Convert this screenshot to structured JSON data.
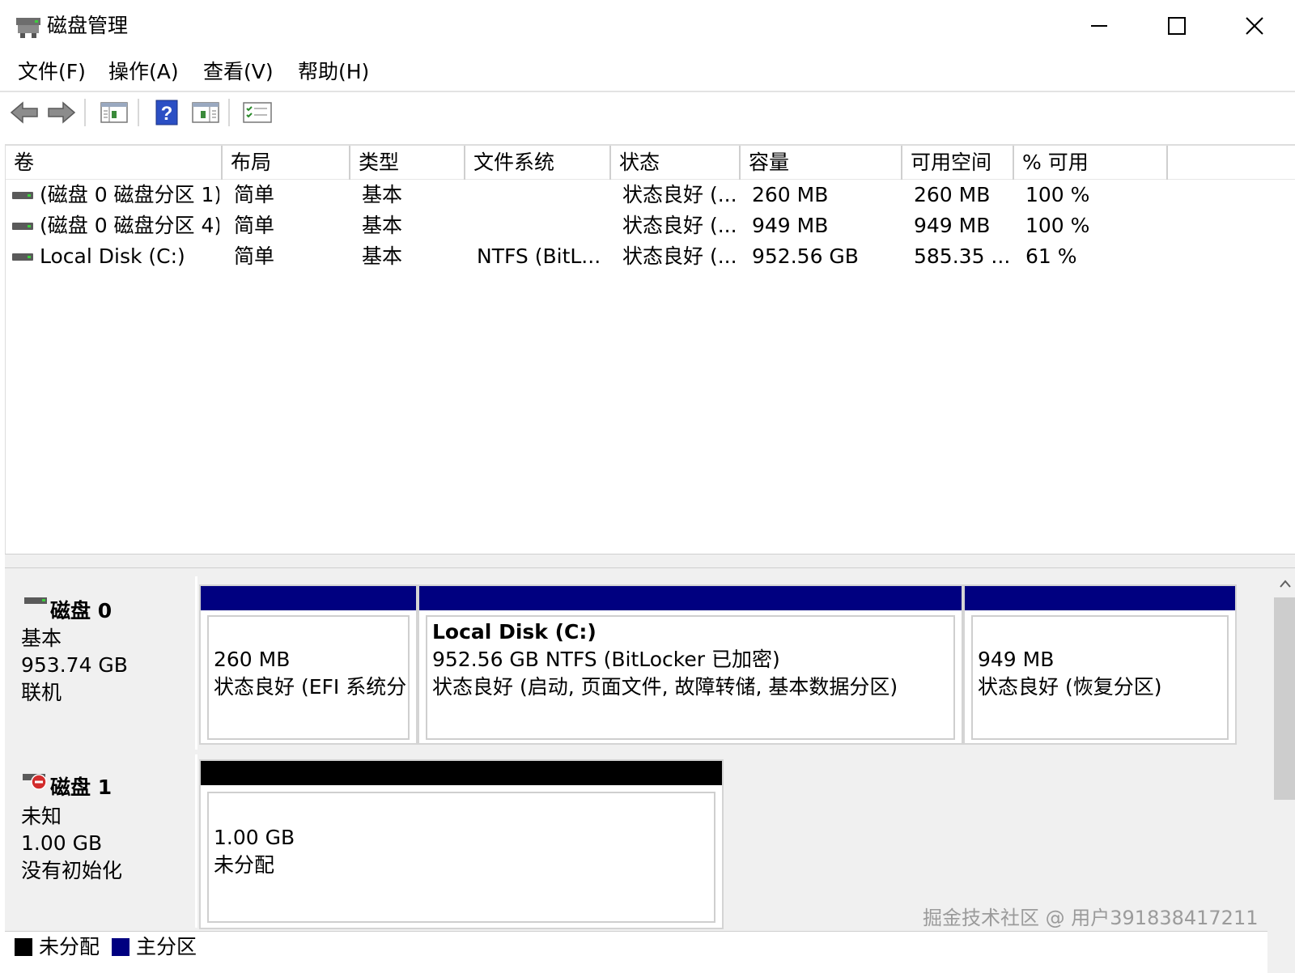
{
  "window": {
    "title": "磁盘管理",
    "controls": {
      "minimize": "—",
      "maximize": "☐",
      "close": "✕"
    }
  },
  "menu": [
    {
      "label": "文件(F)"
    },
    {
      "label": "操作(A)"
    },
    {
      "label": "查看(V)"
    },
    {
      "label": "帮助(H)"
    }
  ],
  "toolbar": {
    "icons": [
      "back-arrow-icon",
      "forward-arrow-icon",
      "console-tree-icon",
      "help-icon",
      "action-pane-icon",
      "properties-list-icon"
    ],
    "help_glyph": "?"
  },
  "volume_list": {
    "columns": [
      "卷",
      "布局",
      "类型",
      "文件系统",
      "状态",
      "容量",
      "可用空间",
      "% 可用"
    ],
    "rows": [
      {
        "volume": "(磁盘 0 磁盘分区 1)",
        "layout": "简单",
        "type": "基本",
        "filesystem": "",
        "status": "状态良好 (...",
        "capacity": "260 MB",
        "free": "260 MB",
        "percent": "100 %"
      },
      {
        "volume": "(磁盘 0 磁盘分区 4)",
        "layout": "简单",
        "type": "基本",
        "filesystem": "",
        "status": "状态良好 (...",
        "capacity": "949 MB",
        "free": "949 MB",
        "percent": "100 %"
      },
      {
        "volume": "Local Disk (C:)",
        "layout": "简单",
        "type": "基本",
        "filesystem": "NTFS (BitL...",
        "status": "状态良好 (...",
        "capacity": "952.56 GB",
        "free": "585.35 ...",
        "percent": "61 %"
      }
    ]
  },
  "disks": [
    {
      "name": "磁盘 0",
      "type": "基本",
      "size": "953.74 GB",
      "state": "联机",
      "partitions": [
        {
          "title": "",
          "line1": "260 MB",
          "line2": "状态良好 (EFI 系统分区)"
        },
        {
          "title": "Local Disk  (C:)",
          "line1": "952.56 GB NTFS (BitLocker 已加密)",
          "line2": "状态良好 (启动, 页面文件, 故障转储, 基本数据分区)"
        },
        {
          "title": "",
          "line1": "949 MB",
          "line2": "状态良好 (恢复分区)"
        }
      ]
    },
    {
      "name": "磁盘 1",
      "type": "未知",
      "size": "1.00 GB",
      "state": "没有初始化",
      "partitions": [
        {
          "title": "",
          "line1": "1.00 GB",
          "line2": "未分配"
        }
      ]
    }
  ],
  "legend": [
    {
      "label": "未分配",
      "color": "#000000"
    },
    {
      "label": "主分区",
      "color": "#000080"
    }
  ],
  "colors": {
    "primary_partition": "#000080",
    "unallocated": "#000000",
    "disk_error_badge": "#d22d2d"
  },
  "watermark": "掘金技术社区 @ 用户391838417211"
}
